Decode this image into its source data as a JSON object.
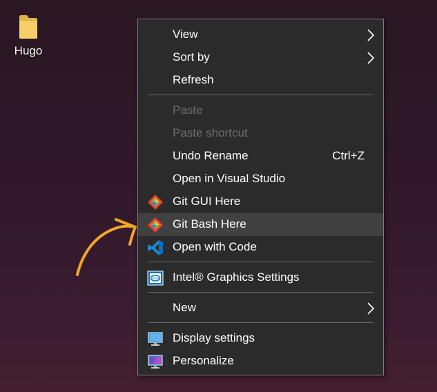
{
  "desktop": {
    "folder_label": "Hugo"
  },
  "menu": {
    "view": "View",
    "sort_by": "Sort by",
    "refresh": "Refresh",
    "paste": "Paste",
    "paste_shortcut": "Paste shortcut",
    "undo_rename": "Undo Rename",
    "undo_shortcut": "Ctrl+Z",
    "open_visual_studio": "Open in Visual Studio",
    "git_gui": "Git GUI Here",
    "git_bash": "Git Bash Here",
    "open_code": "Open with Code",
    "intel_graphics": "Intel® Graphics Settings",
    "new": "New",
    "display_settings": "Display settings",
    "personalize": "Personalize"
  },
  "colors": {
    "menu_bg": "#2b2b2b",
    "highlight": "#414141",
    "disabled_text": "#6d6d6d",
    "annotation_arrow": "#f5a623"
  },
  "icons": [
    "folder-icon",
    "git-icon",
    "vscode-icon",
    "intel-icon",
    "display-icon",
    "personalize-icon",
    "chevron-right-icon"
  ]
}
